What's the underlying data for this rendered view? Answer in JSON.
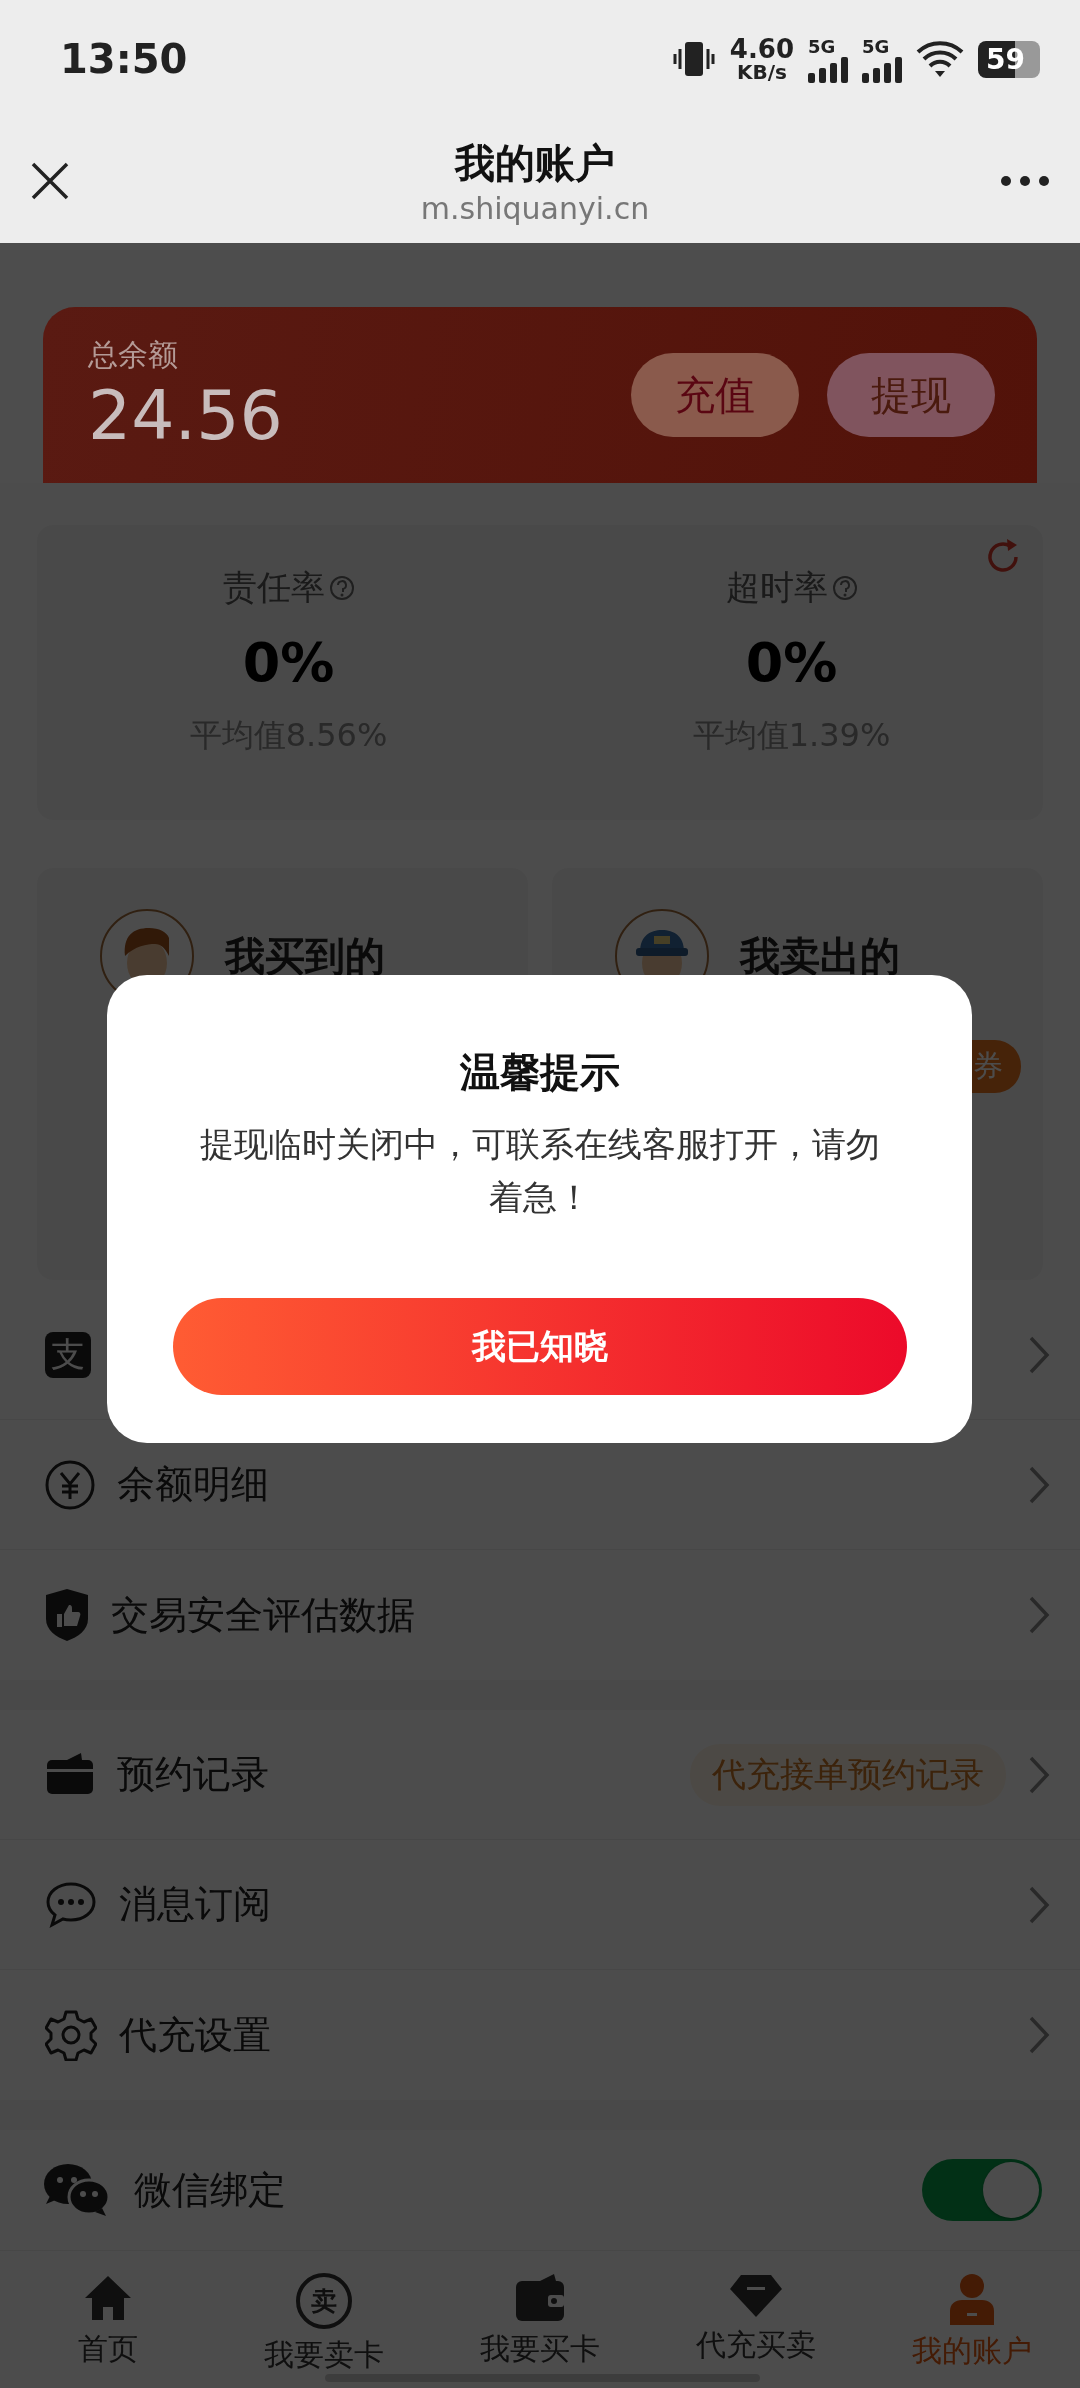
{
  "status_bar": {
    "time": "13:50",
    "net_speed": "4.60",
    "net_unit": "KB/s",
    "sim_labels": [
      "5G",
      "5G"
    ],
    "battery": "59"
  },
  "header": {
    "title": "我的账户",
    "url": "m.shiquanyi.cn"
  },
  "balance": {
    "label": "总余额",
    "amount": "24.56",
    "buttons": [
      {
        "label": "充值",
        "kind": "recharge"
      },
      {
        "label": "提现",
        "kind": "withdraw"
      }
    ]
  },
  "stats": [
    {
      "label": "责任率",
      "value": "0%",
      "average": "平均值8.56%"
    },
    {
      "label": "超时率",
      "value": "0%",
      "average": "平均值1.39%"
    }
  ],
  "order_cards": [
    {
      "title": "我买到的"
    },
    {
      "title": "我卖出的",
      "badge": "券"
    }
  ],
  "menu_groups": [
    [
      {
        "icon_text": "支"
      },
      {
        "label": "余额明细"
      },
      {
        "label": "交易安全评估数据"
      }
    ],
    [
      {
        "label": "预约记录",
        "tag": "代充接单预约记录"
      },
      {
        "label": "消息订阅"
      },
      {
        "label": "代充设置"
      }
    ]
  ],
  "wechat": {
    "label": "微信绑定",
    "on": true
  },
  "tab_bar": [
    {
      "label": "首页",
      "selected": false
    },
    {
      "icon_text": "卖",
      "label": "我要卖卡",
      "selected": false
    },
    {
      "label": "我要买卡",
      "selected": false
    },
    {
      "label": "代充买卖",
      "selected": false
    },
    {
      "label": "我的账户",
      "selected": true
    }
  ],
  "dialog": {
    "title": "温馨提示",
    "message": "提现临时关闭中，可联系在线客服打开，请勿着急！",
    "button": "我已知晓"
  }
}
